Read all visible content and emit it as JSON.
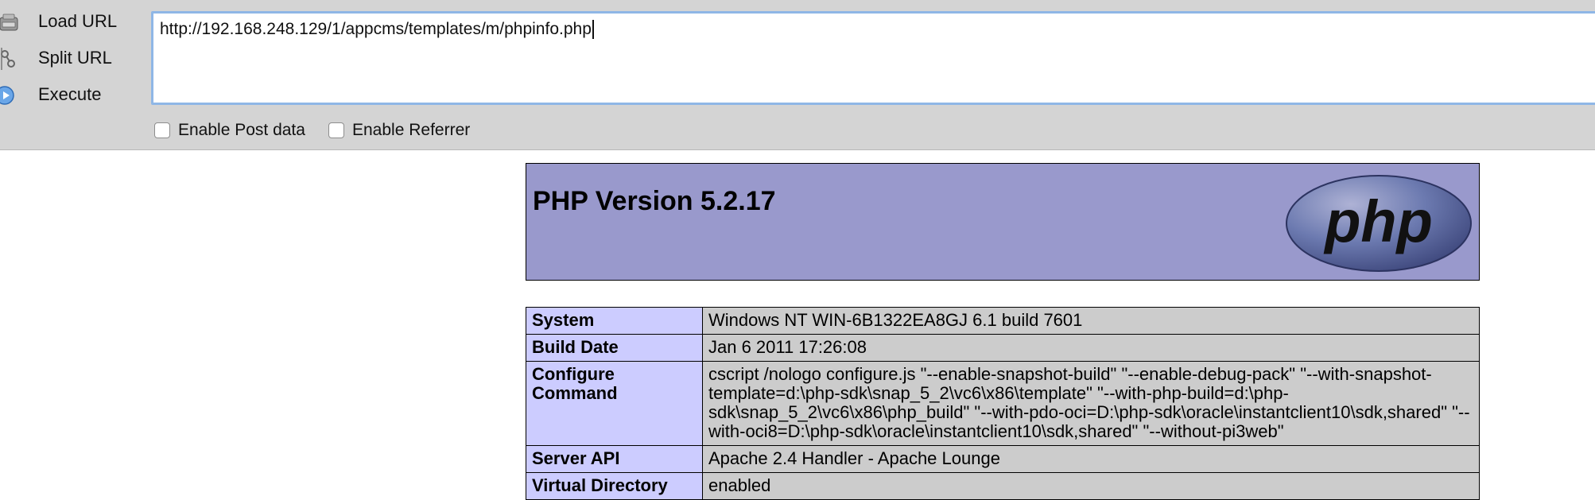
{
  "toolbar": {
    "load_url": "Load URL",
    "split_url": "Split URL",
    "execute": "Execute",
    "url": "http://192.168.248.129/1/appcms/templates/m/phpinfo.php",
    "enable_post": "Enable Post data",
    "enable_referrer": "Enable Referrer"
  },
  "phpinfo": {
    "title": "PHP Version 5.2.17",
    "logo_text": "php",
    "rows": [
      {
        "key": "System",
        "value": "Windows NT WIN-6B1322EA8GJ 6.1 build 7601"
      },
      {
        "key": "Build Date",
        "value": "Jan 6 2011 17:26:08"
      },
      {
        "key": "Configure Command",
        "value": "cscript /nologo configure.js \"--enable-snapshot-build\" \"--enable-debug-pack\" \"--with-snapshot-template=d:\\php-sdk\\snap_5_2\\vc6\\x86\\template\" \"--with-php-build=d:\\php-sdk\\snap_5_2\\vc6\\x86\\php_build\" \"--with-pdo-oci=D:\\php-sdk\\oracle\\instantclient10\\sdk,shared\" \"--with-oci8=D:\\php-sdk\\oracle\\instantclient10\\sdk,shared\" \"--without-pi3web\""
      },
      {
        "key": "Server API",
        "value": "Apache 2.4 Handler - Apache Lounge"
      },
      {
        "key": "Virtual Directory",
        "value": "enabled"
      }
    ]
  },
  "colors": {
    "header_bg": "#9999cc",
    "key_bg": "#ccccff",
    "value_bg": "#cccccc",
    "toolbar_bg": "#d4d4d4",
    "url_border": "#8fb7e6"
  }
}
